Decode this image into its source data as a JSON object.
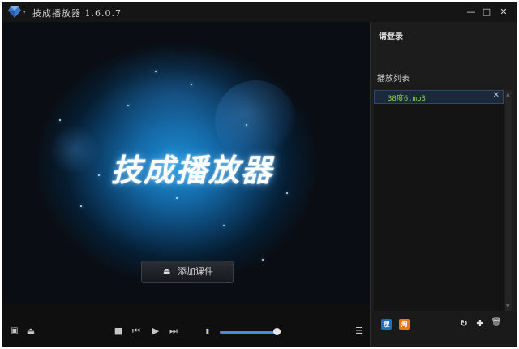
{
  "app": {
    "title": "技成播放器 1.6.0.7",
    "logo_caret": "▾",
    "accent_color": "#3b8fe0"
  },
  "window_controls": {
    "minimize": "—",
    "maximize": "□",
    "close": "✕"
  },
  "splash": {
    "title": "技成播放器",
    "add_button_icon": "eject-icon",
    "add_button_glyph": "⏏",
    "add_button_label": "添加课件"
  },
  "sidebar": {
    "login_label": "请登录",
    "playlist_title": "播放列表",
    "items": [
      {
        "name": "38度6.mp3",
        "close": "✕"
      }
    ],
    "scroll_up": "▲",
    "scroll_down": "▼",
    "bottom": {
      "search_badge": "搜",
      "taobao_badge": "淘",
      "refresh": "↻",
      "add": "✚",
      "delete": "🗑"
    }
  },
  "controls": {
    "mini_mode": "▣",
    "eject": "⏏",
    "stop": "■",
    "prev": "⏮",
    "play": "▶",
    "next": "⏭",
    "volume_icon": "▮",
    "volume_level": 0.92,
    "playlist_toggle": "☰"
  }
}
